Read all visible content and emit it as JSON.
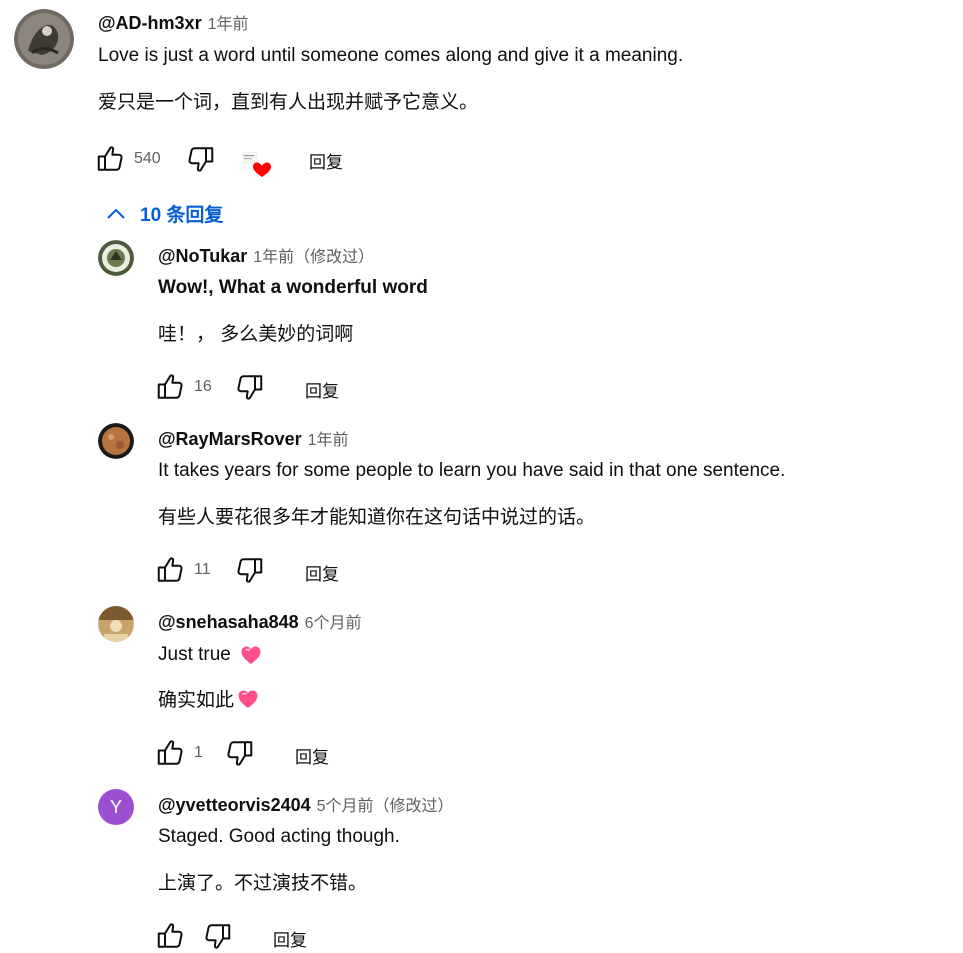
{
  "main": {
    "author": "@AD-hm3xr",
    "time": "1年前",
    "text_en": "Love is just a word until someone comes along and give it a meaning.",
    "text_zh": "爱只是一个词，直到有人出现并赋予它意义。",
    "likes": "540",
    "reply_label": "回复"
  },
  "replies_toggle": {
    "label": "10 条回复"
  },
  "replies": [
    {
      "author": "@NoTukar",
      "time": "1年前（修改过）",
      "text_en": "Wow!, What a wonderful word",
      "text_zh": "哇！， 多么美妙的词啊",
      "likes": "16",
      "reply_label": "回复"
    },
    {
      "author": "@RayMarsRover",
      "time": "1年前",
      "text_en": "It takes years for some people to learn you have said in that one sentence.",
      "text_zh": "有些人要花很多年才能知道你在这句话中说过的话。",
      "likes": "11",
      "reply_label": "回复"
    },
    {
      "author": "@snehasaha848",
      "time": "6个月前",
      "text_en": "Just true",
      "text_zh": "确实如此",
      "likes": "1",
      "reply_label": "回复"
    },
    {
      "author": "@yvetteorvis2404",
      "time": "5个月前（修改过）",
      "text_en": "Staged. Good acting though.",
      "text_zh": "上演了。不过演技不错。",
      "likes": "",
      "reply_label": "回复",
      "avatar_letter": "Y"
    }
  ],
  "colors": {
    "link_blue": "#065fd4",
    "heart_red": "#ff0000",
    "avatar_purple": "#9c4fcf",
    "pink_heart": "#ff4f8b"
  }
}
